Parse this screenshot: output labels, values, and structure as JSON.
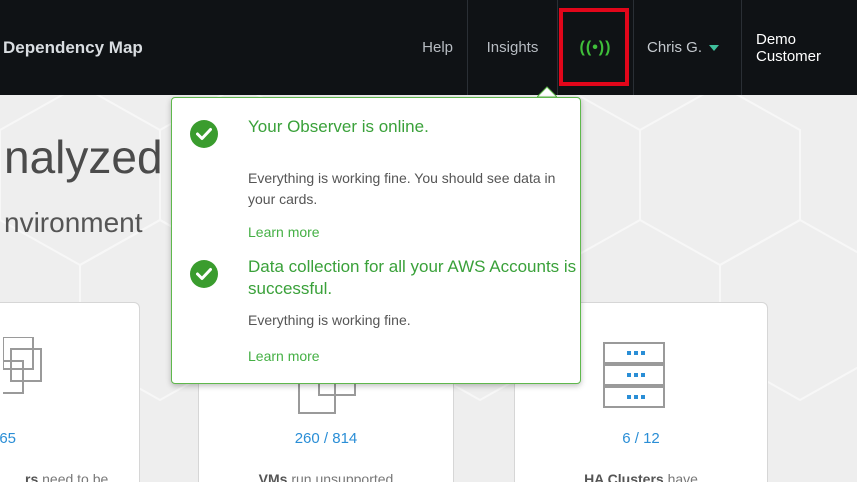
{
  "header": {
    "app_title": "Dependency Map",
    "help_label": "Help",
    "insights_label": "Insights",
    "observer_icon": "broadcast-signal-icon",
    "observer_glyph": "((•))",
    "user_label": "Chris G.",
    "customer_label": "Demo Customer",
    "accent_color": "#3fbf3a",
    "highlight_color": "#e2061a"
  },
  "page": {
    "heading": "nalyzed",
    "subheading": "nvironment"
  },
  "cards": [
    {
      "value": "/ 65",
      "desc_strong": "rs",
      "desc_rest": " need to be"
    },
    {
      "value": "260 / 814",
      "desc_strong": "VMs",
      "desc_rest": " run unsupported"
    },
    {
      "value": "6 / 12",
      "desc_strong": "HA Clusters",
      "desc_rest": " have"
    }
  ],
  "popover": {
    "items": [
      {
        "title": "Your Observer is online.",
        "body": "Everything is working fine. You should see data in your cards.",
        "link": "Learn more"
      },
      {
        "title": "Data collection for all your AWS Accounts is successful.",
        "body": "Everything is working fine.",
        "link": "Learn more"
      }
    ]
  }
}
